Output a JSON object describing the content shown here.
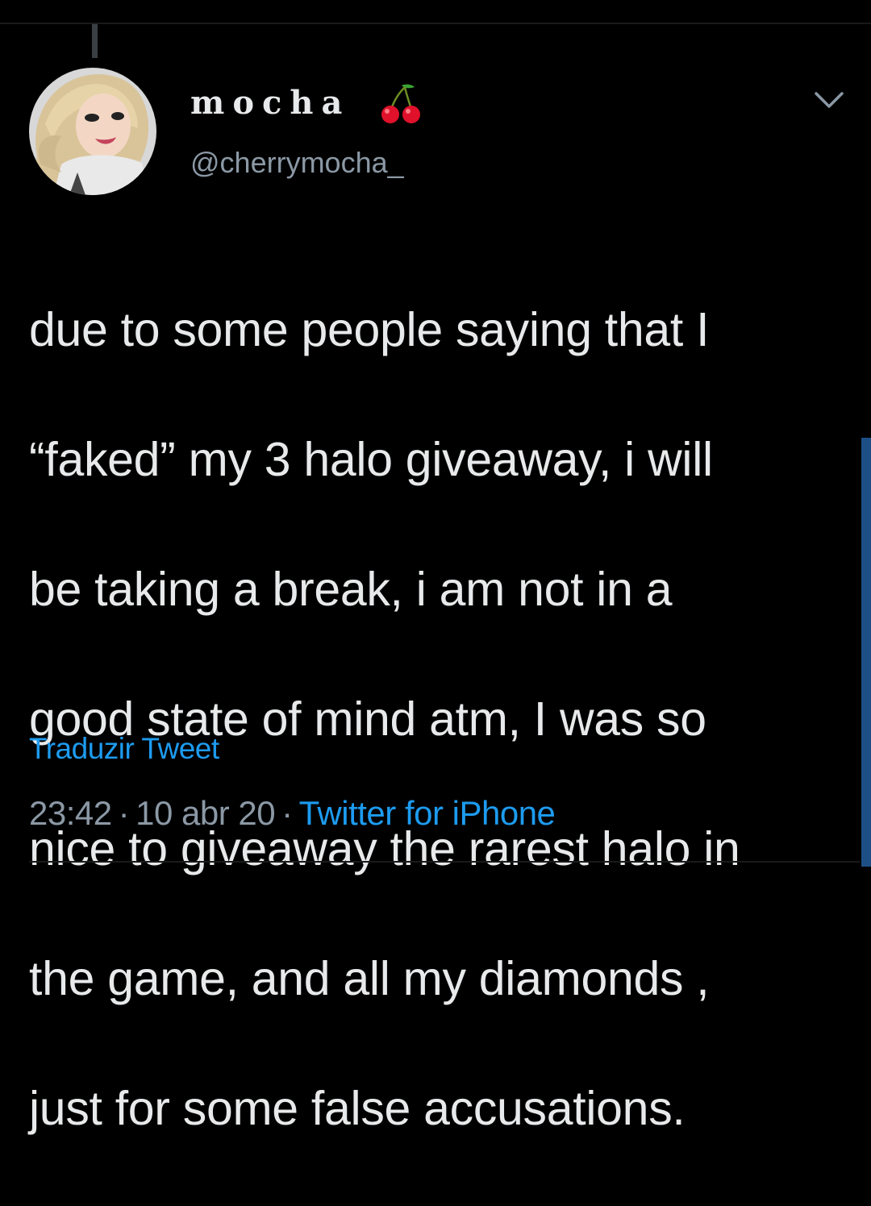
{
  "tweet": {
    "author": {
      "display_name": "mocha",
      "name_emoji": "cherries-icon",
      "handle": "@cherrymocha_"
    },
    "text_lines": [
      "due to some people saying that I",
      "“faked” my 3 halo giveaway, i will",
      "be taking a break, i am not in a",
      "good state of mind atm, I was so",
      "nice to giveaway the rarest halo in",
      "the game, and all my diamonds ,",
      "just for some false accusations."
    ],
    "translate_label": "Traduzir Tweet",
    "time": "23:42",
    "date": "10 abr 20",
    "source": "Twitter for iPhone",
    "separator": "·"
  },
  "icons": {
    "menu": "chevron-down-icon",
    "avatar": "avatar"
  },
  "colors": {
    "background": "#000000",
    "text": "#e7e9ea",
    "secondary": "#8b98a5",
    "accent": "#1d9bf0"
  }
}
